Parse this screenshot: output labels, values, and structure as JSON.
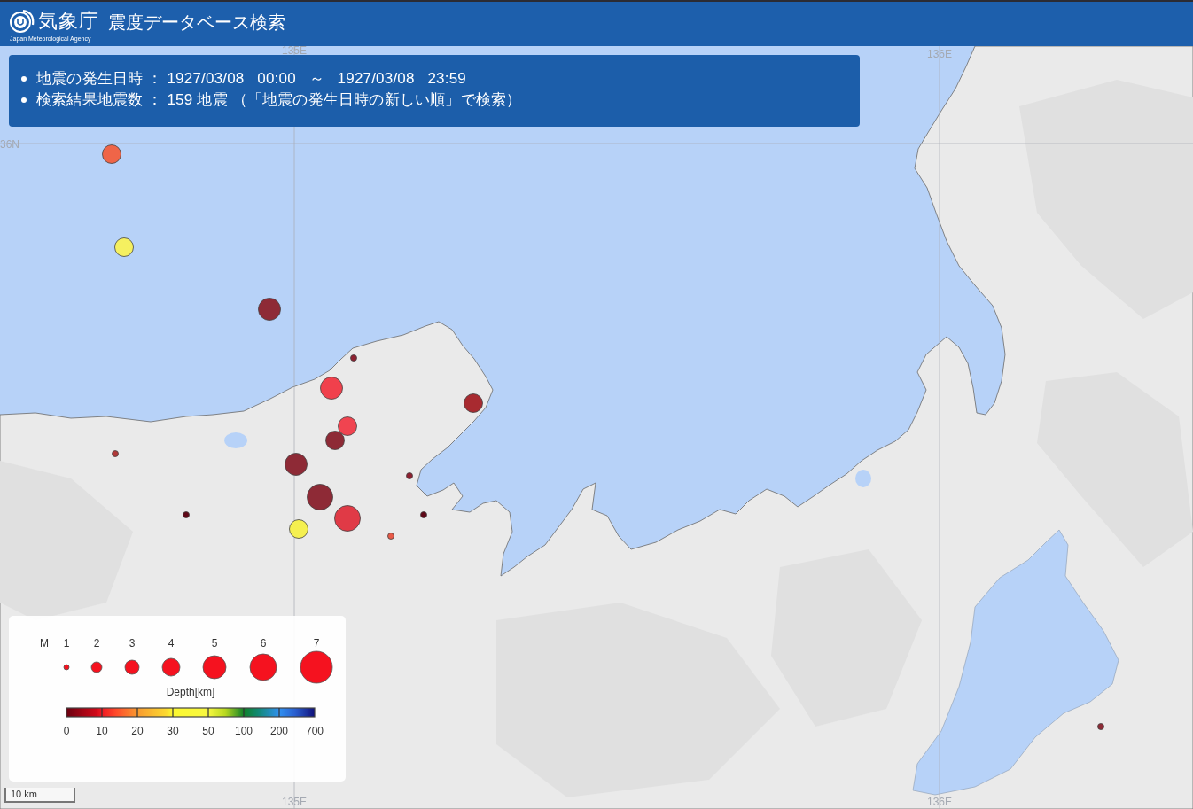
{
  "header": {
    "agency_name": "気象庁",
    "agency_name_en": "Japan Meteorological Agency",
    "title": "震度データベース検索"
  },
  "search_summary": [
    "地震の発生日時 ： 1927/03/08   00:00   ～   1927/03/08   23:59",
    "検索結果地震数 ： 159 地震 （「地震の発生日時の新しい順」で検索）"
  ],
  "grid_labels": {
    "top": [
      "135E",
      "136E"
    ],
    "left": [
      "36N"
    ],
    "bottom": [
      "135E",
      "136E"
    ]
  },
  "earthquakes": [
    {
      "kind": "small",
      "color": "#ef6548"
    },
    {
      "kind": "small",
      "color": "#f5f060"
    },
    {
      "kind": "medium",
      "color": "#8e2a36"
    },
    {
      "kind": "tiny",
      "color": "#8e2030"
    },
    {
      "kind": "medium",
      "color": "#f0404c"
    },
    {
      "kind": "small",
      "color": "#a82a30"
    },
    {
      "kind": "small",
      "color": "#f04450"
    },
    {
      "kind": "small",
      "color": "#8e2a36"
    },
    {
      "kind": "tiny",
      "color": "#b03838"
    },
    {
      "kind": "medium",
      "color": "#8e2a36"
    },
    {
      "kind": "tiny",
      "color": "#8e2030"
    },
    {
      "kind": "large",
      "color": "#8e2a36"
    },
    {
      "kind": "tiny",
      "color": "#600818"
    },
    {
      "kind": "large",
      "color": "#e03a46"
    },
    {
      "kind": "tiny",
      "color": "#600818"
    },
    {
      "kind": "small",
      "color": "#f5f050"
    },
    {
      "kind": "tiny",
      "color": "#e85a48"
    },
    {
      "kind": "tiny",
      "color": "#8e2a36"
    }
  ],
  "legend": {
    "magnitude_label": "M",
    "magnitudes": [
      "1",
      "2",
      "3",
      "4",
      "5",
      "6",
      "7"
    ],
    "depth_title": "Depth[km]",
    "depth_ticks": [
      "0",
      "10",
      "20",
      "30",
      "50",
      "100",
      "200",
      "700"
    ]
  },
  "scale_bar": "10 km"
}
